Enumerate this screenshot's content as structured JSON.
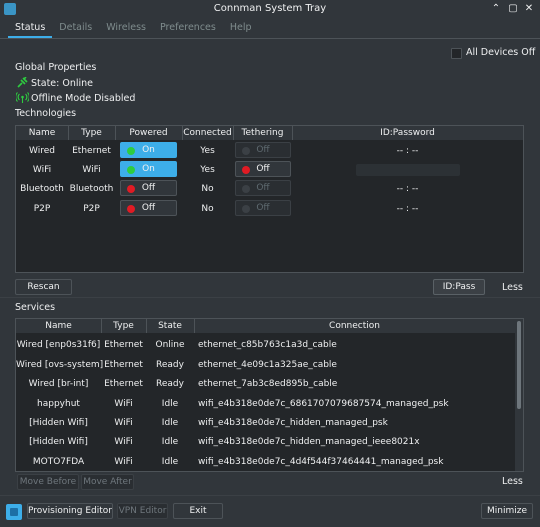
{
  "window": {
    "title": "Connman System Tray",
    "controls": {
      "pin": "⌃",
      "maximize": "▢",
      "close": "✕"
    }
  },
  "tabs": [
    {
      "label": "Status"
    },
    {
      "label": "Details"
    },
    {
      "label": "Wireless"
    },
    {
      "label": "Preferences"
    },
    {
      "label": "Help"
    }
  ],
  "global": {
    "heading": "Global Properties",
    "all_devices_off": "All Devices Off",
    "state": "State: Online",
    "offline_mode": "Offline Mode Disabled"
  },
  "technologies": {
    "heading": "Technologies",
    "columns": [
      "Name",
      "Type",
      "Powered",
      "Connected",
      "Tethering",
      "ID:Password"
    ],
    "rows": [
      {
        "name": "Wired",
        "type": "Ethernet",
        "powered": "On",
        "connected": "Yes",
        "tethering": "Off",
        "idpass": "-- : --"
      },
      {
        "name": "WiFi",
        "type": "WiFi",
        "powered": "On",
        "connected": "Yes",
        "tethering": "Off",
        "idpass": ""
      },
      {
        "name": "Bluetooth",
        "type": "Bluetooth",
        "powered": "Off",
        "connected": "No",
        "tethering": "Off",
        "idpass": "-- : --"
      },
      {
        "name": "P2P",
        "type": "P2P",
        "powered": "Off",
        "connected": "No",
        "tethering": "Off",
        "idpass": "-- : --"
      }
    ],
    "rescan": "Rescan",
    "idpass_button": "ID:Pass",
    "less": "Less"
  },
  "services": {
    "heading": "Services",
    "columns": [
      "Name",
      "Type",
      "State",
      "Connection"
    ],
    "rows": [
      {
        "name": "Wired [enp0s31f6]",
        "type": "Ethernet",
        "state": "Online",
        "connection": "ethernet_c85b763c1a3d_cable"
      },
      {
        "name": "Wired [ovs-system]",
        "type": "Ethernet",
        "state": "Ready",
        "connection": "ethernet_4e09c1a325ae_cable"
      },
      {
        "name": "Wired [br-int]",
        "type": "Ethernet",
        "state": "Ready",
        "connection": "ethernet_7ab3c8ed895b_cable"
      },
      {
        "name": "happyhut",
        "type": "WiFi",
        "state": "Idle",
        "connection": "wifi_e4b318e0de7c_6861707079687574_managed_psk"
      },
      {
        "name": "[Hidden Wifi]",
        "type": "WiFi",
        "state": "Idle",
        "connection": "wifi_e4b318e0de7c_hidden_managed_psk"
      },
      {
        "name": "[Hidden Wifi]",
        "type": "WiFi",
        "state": "Idle",
        "connection": "wifi_e4b318e0de7c_hidden_managed_ieee8021x"
      },
      {
        "name": "MOTO7FDA",
        "type": "WiFi",
        "state": "Idle",
        "connection": "wifi_e4b318e0de7c_4d4f544f37464441_managed_psk"
      }
    ],
    "move_before": "Move Before",
    "move_after": "Move After",
    "less": "Less"
  },
  "footer": {
    "provisioning_editor": "Provisioning Editor",
    "vpn_editor": "VPN Editor",
    "exit": "Exit",
    "minimize": "Minimize"
  },
  "colors": {
    "accent": "#3daee9",
    "background": "#31363b",
    "panel": "#232629",
    "led_green": "#2ecc40",
    "led_red": "#e01b24"
  }
}
